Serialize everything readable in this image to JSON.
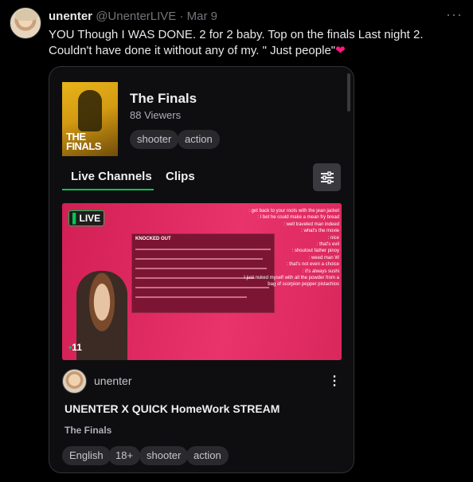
{
  "tweet": {
    "name": "unenter",
    "handle": "@UnenterLIVE",
    "separator": "·",
    "date": "Mar 9",
    "more": "···",
    "text": "YOU Though I WAS DONE. 2 for 2 baby. Top on the finals Last night 2. Couldn't have done it without any of my. \" Just people\"",
    "heart": "❤"
  },
  "card": {
    "game": {
      "art_text": "THE FINALS",
      "title": "The Finals",
      "viewers": "88 Viewers",
      "tags": [
        "shooter",
        "action"
      ]
    },
    "tabs": [
      "Live Channels",
      "Clips"
    ],
    "stream": {
      "live_badge": "LIVE",
      "viewer_count": "11",
      "chat": [
        ": get back to your roots with the jean jacket",
        ": I bet he could make a mean fry bread",
        ": well traveled man indeed",
        ": what's the movie",
        ": nice",
        ": that's evil",
        ": shoutout father pinoy",
        ": weed man W",
        ": that's not even a choice",
        ": it's always sushi",
        "I just nuked myself with all the powder from a",
        "bag of scorpion pepper pistachios"
      ],
      "overlay_title": "KNOCKED OUT",
      "streamer": "unenter",
      "title": "UNENTER X QUICK HomeWork STREAM",
      "game": "The Finals",
      "tags": [
        "English",
        "18+",
        "shooter",
        "action"
      ]
    }
  },
  "colors": {
    "accent_green": "#00c853",
    "heart": "#f91880",
    "thumbnail": "#e0245e"
  }
}
